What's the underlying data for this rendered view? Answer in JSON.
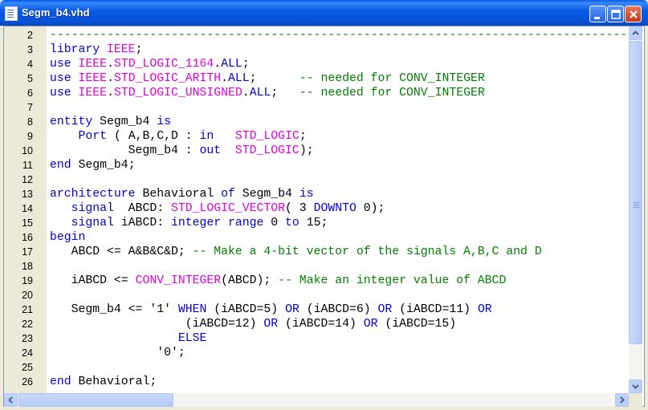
{
  "window": {
    "title": "Segm_b4.vhd",
    "icon": "document-icon"
  },
  "editor": {
    "lines": [
      {
        "num": "2",
        "segments": [
          {
            "t": "--------------------------------------------------------------------------------------------",
            "c": "cm"
          }
        ]
      },
      {
        "num": "3",
        "segments": [
          {
            "t": "library ",
            "c": "kw"
          },
          {
            "t": "IEEE",
            "c": "ty"
          },
          {
            "t": ";",
            "c": "pl"
          }
        ]
      },
      {
        "num": "4",
        "segments": [
          {
            "t": "use ",
            "c": "kw"
          },
          {
            "t": "IEEE",
            "c": "ty"
          },
          {
            "t": ".",
            "c": "pl"
          },
          {
            "t": "STD_LOGIC_1164",
            "c": "ty"
          },
          {
            "t": ".",
            "c": "pl"
          },
          {
            "t": "ALL",
            "c": "kw"
          },
          {
            "t": ";",
            "c": "pl"
          }
        ]
      },
      {
        "num": "5",
        "segments": [
          {
            "t": "use ",
            "c": "kw"
          },
          {
            "t": "IEEE",
            "c": "ty"
          },
          {
            "t": ".",
            "c": "pl"
          },
          {
            "t": "STD_LOGIC_ARITH",
            "c": "ty"
          },
          {
            "t": ".",
            "c": "pl"
          },
          {
            "t": "ALL",
            "c": "kw"
          },
          {
            "t": ";      ",
            "c": "pl"
          },
          {
            "t": "-- needed for CONV_INTEGER",
            "c": "cm"
          }
        ]
      },
      {
        "num": "6",
        "segments": [
          {
            "t": "use ",
            "c": "kw"
          },
          {
            "t": "IEEE",
            "c": "ty"
          },
          {
            "t": ".",
            "c": "pl"
          },
          {
            "t": "STD_LOGIC_UNSIGNED",
            "c": "ty"
          },
          {
            "t": ".",
            "c": "pl"
          },
          {
            "t": "ALL",
            "c": "kw"
          },
          {
            "t": ";   ",
            "c": "pl"
          },
          {
            "t": "-- needed for CONV_INTEGER",
            "c": "cm"
          }
        ]
      },
      {
        "num": "7",
        "segments": []
      },
      {
        "num": "8",
        "segments": [
          {
            "t": "entity ",
            "c": "kw"
          },
          {
            "t": "Segm_b4 ",
            "c": "pl"
          },
          {
            "t": "is",
            "c": "kw"
          }
        ]
      },
      {
        "num": "9",
        "segments": [
          {
            "t": "    ",
            "c": "pl"
          },
          {
            "t": "Port",
            "c": "kw"
          },
          {
            "t": " ( A,B,C,D : ",
            "c": "pl"
          },
          {
            "t": "in",
            "c": "kw"
          },
          {
            "t": "   ",
            "c": "pl"
          },
          {
            "t": "STD_LOGIC",
            "c": "ty"
          },
          {
            "t": ";",
            "c": "pl"
          }
        ]
      },
      {
        "num": "10",
        "segments": [
          {
            "t": "           Segm_b4 : ",
            "c": "pl"
          },
          {
            "t": "out",
            "c": "kw"
          },
          {
            "t": "  ",
            "c": "pl"
          },
          {
            "t": "STD_LOGIC",
            "c": "ty"
          },
          {
            "t": ");",
            "c": "pl"
          }
        ]
      },
      {
        "num": "11",
        "segments": [
          {
            "t": "end ",
            "c": "kw"
          },
          {
            "t": "Segm_b4;",
            "c": "pl"
          }
        ]
      },
      {
        "num": "12",
        "segments": []
      },
      {
        "num": "13",
        "segments": [
          {
            "t": "architecture ",
            "c": "kw"
          },
          {
            "t": "Behavioral ",
            "c": "pl"
          },
          {
            "t": "of ",
            "c": "kw"
          },
          {
            "t": "Segm_b4 ",
            "c": "pl"
          },
          {
            "t": "is",
            "c": "kw"
          }
        ]
      },
      {
        "num": "14",
        "segments": [
          {
            "t": "   ",
            "c": "pl"
          },
          {
            "t": "signal",
            "c": "kw"
          },
          {
            "t": "  ABCD: ",
            "c": "pl"
          },
          {
            "t": "STD_LOGIC_VECTOR",
            "c": "ty"
          },
          {
            "t": "( 3 ",
            "c": "pl"
          },
          {
            "t": "DOWNTO",
            "c": "kw"
          },
          {
            "t": " 0);",
            "c": "pl"
          }
        ]
      },
      {
        "num": "15",
        "segments": [
          {
            "t": "   ",
            "c": "pl"
          },
          {
            "t": "signal",
            "c": "kw"
          },
          {
            "t": " iABCD: ",
            "c": "pl"
          },
          {
            "t": "integer range",
            "c": "kw"
          },
          {
            "t": " 0 ",
            "c": "pl"
          },
          {
            "t": "to",
            "c": "kw"
          },
          {
            "t": " 15;",
            "c": "pl"
          }
        ]
      },
      {
        "num": "16",
        "segments": [
          {
            "t": "begin",
            "c": "kw"
          }
        ]
      },
      {
        "num": "17",
        "segments": [
          {
            "t": "   ABCD <= A&B&C&D; ",
            "c": "pl"
          },
          {
            "t": "-- Make a 4-bit vector of the signals A,B,C and D",
            "c": "cm"
          }
        ]
      },
      {
        "num": "18",
        "segments": []
      },
      {
        "num": "19",
        "segments": [
          {
            "t": "   iABCD <= ",
            "c": "pl"
          },
          {
            "t": "CONV_INTEGER",
            "c": "ty"
          },
          {
            "t": "(ABCD); ",
            "c": "pl"
          },
          {
            "t": "-- Make an integer value of ABCD",
            "c": "cm"
          }
        ]
      },
      {
        "num": "20",
        "segments": []
      },
      {
        "num": "21",
        "segments": [
          {
            "t": "   Segm_b4 <= '1' ",
            "c": "pl"
          },
          {
            "t": "WHEN",
            "c": "kw"
          },
          {
            "t": " (iABCD=5) ",
            "c": "pl"
          },
          {
            "t": "OR",
            "c": "kw"
          },
          {
            "t": " (iABCD=6) ",
            "c": "pl"
          },
          {
            "t": "OR",
            "c": "kw"
          },
          {
            "t": " (iABCD=11) ",
            "c": "pl"
          },
          {
            "t": "OR",
            "c": "kw"
          }
        ]
      },
      {
        "num": "22",
        "segments": [
          {
            "t": "                   (iABCD=12) ",
            "c": "pl"
          },
          {
            "t": "OR",
            "c": "kw"
          },
          {
            "t": " (iABCD=14) ",
            "c": "pl"
          },
          {
            "t": "OR",
            "c": "kw"
          },
          {
            "t": " (iABCD=15)",
            "c": "pl"
          }
        ]
      },
      {
        "num": "23",
        "segments": [
          {
            "t": "                  ",
            "c": "pl"
          },
          {
            "t": "ELSE",
            "c": "kw"
          }
        ]
      },
      {
        "num": "24",
        "segments": [
          {
            "t": "               '0';",
            "c": "pl"
          }
        ]
      },
      {
        "num": "25",
        "segments": []
      },
      {
        "num": "26",
        "segments": [
          {
            "t": "end ",
            "c": "kw"
          },
          {
            "t": "Behavioral;",
            "c": "pl"
          }
        ]
      }
    ]
  },
  "colors": {
    "keyword": "#0000e0",
    "type": "#e000e0",
    "comment": "#008000",
    "plain": "#000000",
    "gutter": "#ece9d8",
    "titlebar": "#0653d9"
  }
}
